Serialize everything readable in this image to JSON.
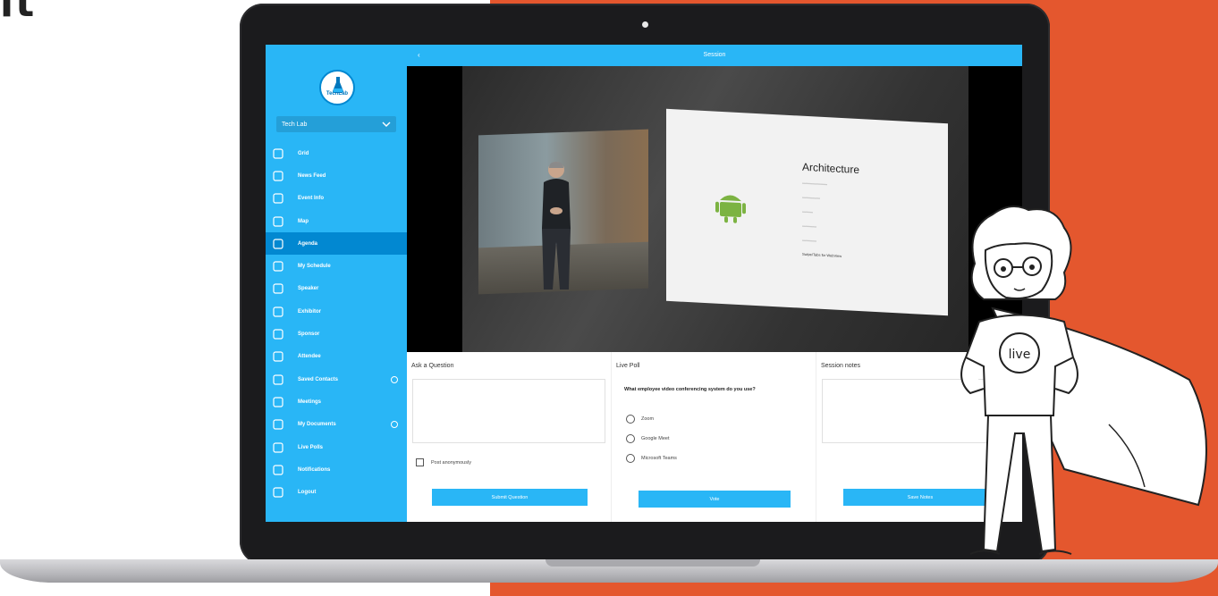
{
  "corner_text": "it",
  "colors": {
    "brand": "#29b6f6",
    "brand_dark": "#0288d1",
    "orange": "#e4572e"
  },
  "app": {
    "logo_text": "TechLab",
    "org_select": {
      "value": "Tech Lab",
      "icon": "chevron-down-icon"
    },
    "back_icon": "back-arrow-icon",
    "title": "Session"
  },
  "sidebar": {
    "items": [
      {
        "label": "Grid",
        "icon": "grid-icon"
      },
      {
        "label": "News Feed",
        "icon": "bell-icon"
      },
      {
        "label": "Event Info",
        "icon": "info-icon"
      },
      {
        "label": "Map",
        "icon": "map-icon"
      },
      {
        "label": "Agenda",
        "icon": "calendar-icon",
        "active": true
      },
      {
        "label": "My Schedule",
        "icon": "schedule-icon"
      },
      {
        "label": "Speaker",
        "icon": "microphone-icon"
      },
      {
        "label": "Exhibitor",
        "icon": "exhibitor-icon"
      },
      {
        "label": "Sponsor",
        "icon": "star-icon"
      },
      {
        "label": "Attendee",
        "icon": "person-icon"
      },
      {
        "label": "Saved Contacts",
        "icon": "contacts-icon",
        "badge": true
      },
      {
        "label": "Meetings",
        "icon": "meetings-icon"
      },
      {
        "label": "My Documents",
        "icon": "documents-icon",
        "badge": true
      },
      {
        "label": "Live Polls",
        "icon": "polls-icon"
      },
      {
        "label": "Notifications",
        "icon": "notification-icon"
      },
      {
        "label": "Logout",
        "icon": "logout-icon"
      }
    ]
  },
  "video": {
    "slide_title": "Architecture",
    "slide_highlight": "Swipe/Tabs for WebView"
  },
  "ask_question": {
    "title": "Ask a Question",
    "checkbox_label": "Post anonymously",
    "button": "Submit Question"
  },
  "live_poll": {
    "title": "Live Poll",
    "question": "What employee video conferencing system do you use?",
    "options": [
      "Zoom",
      "Google Meet",
      "Microsoft Teams"
    ],
    "button": "Vote"
  },
  "session_notes": {
    "title": "Session notes",
    "button": "Save Notes"
  },
  "mascot": {
    "shirt_text": "live"
  }
}
